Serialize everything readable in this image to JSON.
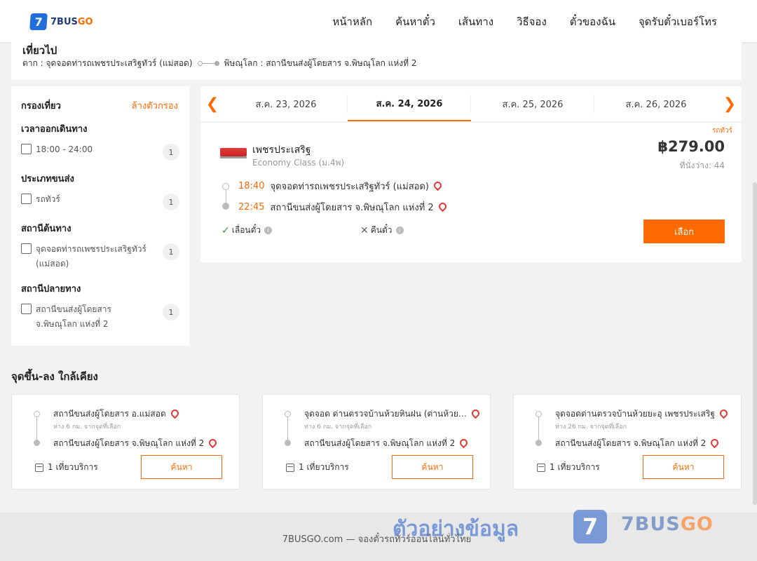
{
  "brand": {
    "logo_digit": "7",
    "logo_text_a": "7BUS",
    "logo_text_b": "GO"
  },
  "nav": [
    "หน้าหลัก",
    "ค้นหาตั๋ว",
    "เส้นทาง",
    "วิธีจอง",
    "ตั๋วของฉัน",
    "จุดรับตั๋วเบอร์โทร"
  ],
  "trip": {
    "title": "เที่ยวไป",
    "from": "ตาก : จุดจอดท่ารถเพชรประเสริฐทัวร์ (แม่สอด)",
    "to": "พิษณุโลก : สถานีขนส่งผู้โดยสาร จ.พิษณุโลก แห่งที่ 2"
  },
  "filter": {
    "title": "กรองเที่ยว",
    "clear": "ล้างตัวกรอง",
    "groups": [
      {
        "title": "เวลาออกเดินทาง",
        "options": [
          {
            "label": "18:00 - 24:00",
            "count": "1"
          }
        ]
      },
      {
        "title": "ประเภทขนส่ง",
        "options": [
          {
            "label": "รถทัวร์",
            "count": "1"
          }
        ]
      },
      {
        "title": "สถานีต้นทาง",
        "options": [
          {
            "label": "จุดจอดท่ารถเพชรประเสริฐทัวร์ (แม่สอด)",
            "count": "1"
          }
        ]
      },
      {
        "title": "สถานีปลายทาง",
        "options": [
          {
            "label": "สถานีขนส่งผู้โดยสาร จ.พิษณุโลก แห่งที่ 2",
            "count": "1"
          }
        ]
      }
    ]
  },
  "dates": [
    "ส.ค. 23, 2026",
    "ส.ค. 24, 2026",
    "ส.ค. 25, 2026",
    "ส.ค. 26, 2026"
  ],
  "active_date_index": 1,
  "result": {
    "type_tag": "รถทัวร์",
    "operator": "เพชรประเสริฐ",
    "class": "Economy Class (ม.4พ)",
    "price": "฿279.00",
    "seats": "ที่นั่งว่าง: 44",
    "depart_time": "18:40",
    "depart_station": "จุดจอดท่ารถเพชรประเสริฐทัวร์ (แม่สอด)",
    "arrive_time": "22:45",
    "arrive_station": "สถานีขนส่งผู้โดยสาร จ.พิษณุโลก แห่งที่ 2",
    "reschedule": "เลื่อนตั๋ว",
    "refund": "คืนตั๋ว",
    "select": "เลือก"
  },
  "nearby": {
    "title": "จุดขึ้น-ลง ใกล้เคียง",
    "cards": [
      {
        "from": "สถานีขนส่งผู้โดยสาร อ.แม่สอด",
        "dist": "ห่าง 6 กม. จากจุดที่เลือก",
        "to": "สถานีขนส่งผู้โดยสาร จ.พิษณุโลก แห่งที่ 2",
        "service": "1 เที่ยวบริการ",
        "button": "ค้นหา"
      },
      {
        "from": "จุดจอด ด่านตรวจบ้านห้วยหินฝน (ด่านห้วยหินฝน)",
        "dist": "ห่าง 6 กม. จากจุดที่เลือก",
        "to": "สถานีขนส่งผู้โดยสาร จ.พิษณุโลก แห่งที่ 2",
        "service": "1 เที่ยวบริการ",
        "button": "ค้นหา"
      },
      {
        "from": "จุดจอดด่านตรวจบ้านห้วยยะอุ เพชรประเสริฐ",
        "dist": "ห่าง 26 กม. จากจุดที่เลือก",
        "to": "สถานีขนส่งผู้โดยสาร จ.พิษณุโลก แห่งที่ 2",
        "service": "1 เที่ยวบริการ",
        "button": "ค้นหา"
      }
    ]
  },
  "footer": "7BUSGO.com — จองตั๋วรถทัวร์ออนไลน์ทั่วไทย",
  "watermark": {
    "text": "ตัวอย่างข้อมูล",
    "logo_digit": "7",
    "brand_a": "7BUS",
    "brand_b": "GO"
  },
  "colors": {
    "accent": "#ff6a00",
    "brand_blue": "#1e6fd9",
    "pin": "#e53935",
    "check": "#2e9e3e"
  }
}
